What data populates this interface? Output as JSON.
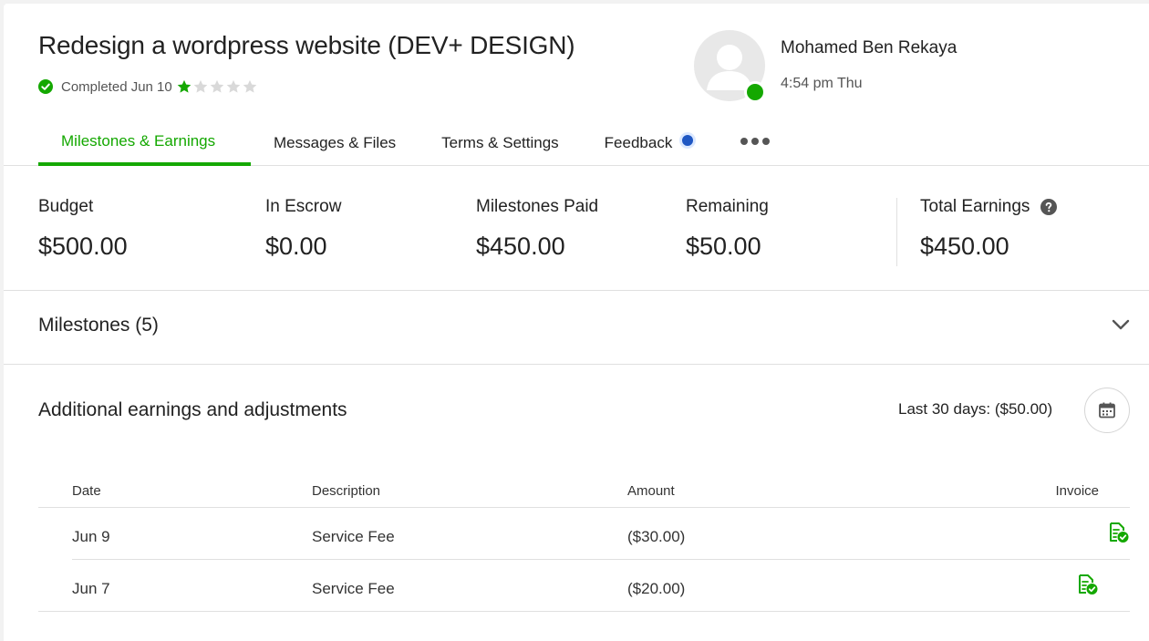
{
  "contract": {
    "title": "Redesign a wordpress website (DEV+ DESIGN)",
    "status": "Completed Jun 10",
    "rating": 1,
    "rating_max": 5
  },
  "user": {
    "name": "Mohamed Ben Rekaya",
    "local_time": "4:54 pm Thu",
    "online": true
  },
  "tabs": [
    {
      "label": "Milestones & Earnings",
      "active": true
    },
    {
      "label": "Messages & Files",
      "active": false
    },
    {
      "label": "Terms & Settings",
      "active": false
    },
    {
      "label": "Feedback",
      "active": false
    }
  ],
  "stats": {
    "budget": {
      "label": "Budget",
      "value": "$500.00"
    },
    "escrow": {
      "label": "In Escrow",
      "value": "$0.00"
    },
    "paid": {
      "label": "Milestones Paid",
      "value": "$450.00"
    },
    "remaining": {
      "label": "Remaining",
      "value": "$50.00"
    },
    "total": {
      "label": "Total Earnings",
      "value": "$450.00"
    }
  },
  "milestones": {
    "label": "Milestones (5)"
  },
  "adjustments": {
    "title": "Additional earnings and adjustments",
    "period": "Last 30 days: ($50.00)",
    "columns": {
      "date": "Date",
      "description": "Description",
      "amount": "Amount",
      "invoice": "Invoice"
    },
    "rows": [
      {
        "date": "Jun 9",
        "description": "Service Fee",
        "amount": "($30.00)"
      },
      {
        "date": "Jun 7",
        "description": "Service Fee",
        "amount": "($20.00)"
      }
    ]
  },
  "colors": {
    "accent": "#14a800",
    "notification": "#1f57c3",
    "star_empty": "#d9d9d9"
  },
  "icons": {
    "status": "check-circle-icon",
    "rating": "star-icon",
    "help": "question-circle-icon",
    "expand": "chevron-down-icon",
    "calendar": "calendar-icon",
    "invoice": "invoice-check-icon"
  }
}
